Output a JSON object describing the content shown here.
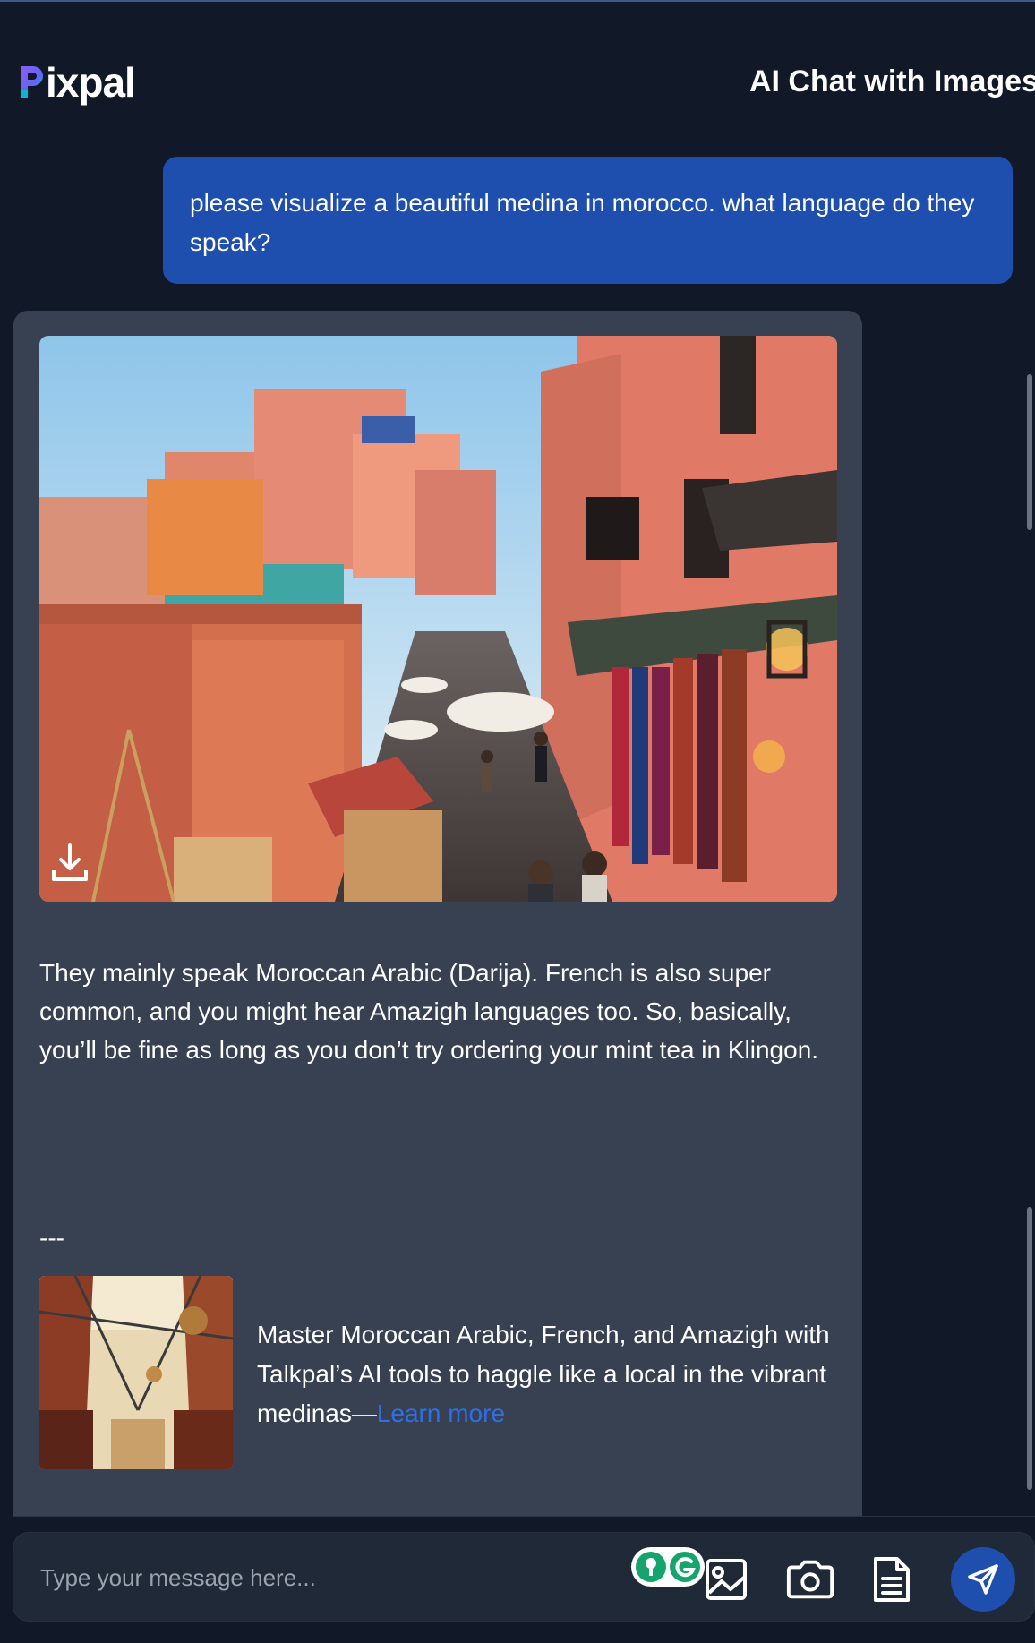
{
  "header": {
    "logo_rest": "ixpal",
    "title": "AI Chat with Images"
  },
  "conversation": {
    "user_message": "please visualize a beautiful medina in morocco. what language do they speak?",
    "ai_reply": "They mainly speak Moroccan Arabic (Darija). French is also super common, and you might hear Amazigh languages too. So, basically, you’ll be fine as long as you don’t try ordering your mint tea in Klingon.",
    "separator": "---",
    "promo_text": "Master Moroccan Arabic, French, and Amazigh with Talkpal’s AI tools to haggle like a local in the vibrant medinas—",
    "promo_link": "Learn more"
  },
  "composer": {
    "placeholder": "Type your message here..."
  },
  "icons": {
    "download": "download-icon",
    "extension": "grammarly-extension-icon",
    "image_upload": "image-upload-icon",
    "camera": "camera-icon",
    "document": "document-icon",
    "send": "send-icon"
  },
  "colors": {
    "background": "#111827",
    "ai_bubble": "#374151",
    "user_bubble": "#1e4fae",
    "link": "#2f6fe6",
    "logo_gradient": [
      "#7c3aed",
      "#06b6d4"
    ]
  }
}
